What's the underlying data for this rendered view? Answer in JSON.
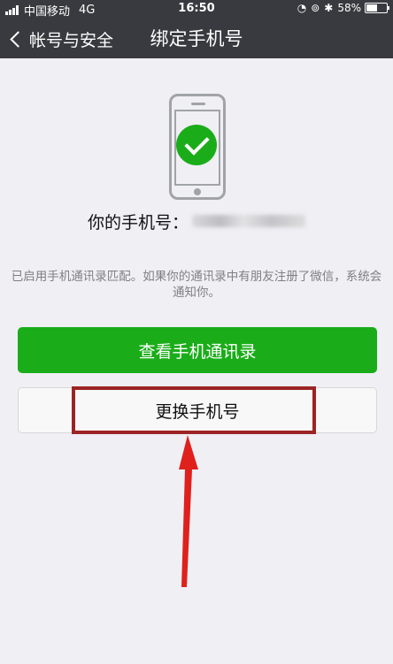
{
  "status_bar": {
    "carrier": "中国移动",
    "network": "4G",
    "time": "16:50",
    "battery_percent": "58%",
    "battery_level": 0.58,
    "icons": [
      "lock-rotation-icon",
      "alarm-icon",
      "bluetooth-icon"
    ]
  },
  "nav": {
    "back_label": "帐号与安全",
    "title": "绑定手机号"
  },
  "main": {
    "phone_label": "你的手机号：",
    "info_text": "已启用手机通讯录匹配。如果你的通讯录中有朋友注册了微信，系统会通知你。",
    "view_contacts_button": "查看手机通讯录",
    "change_phone_button": "更换手机号"
  },
  "colors": {
    "header_bg": "#393a3f",
    "page_bg": "#efeff4",
    "primary_green": "#1aad19",
    "annotation_red": "#e0201c",
    "annotation_box": "#9c2424"
  }
}
